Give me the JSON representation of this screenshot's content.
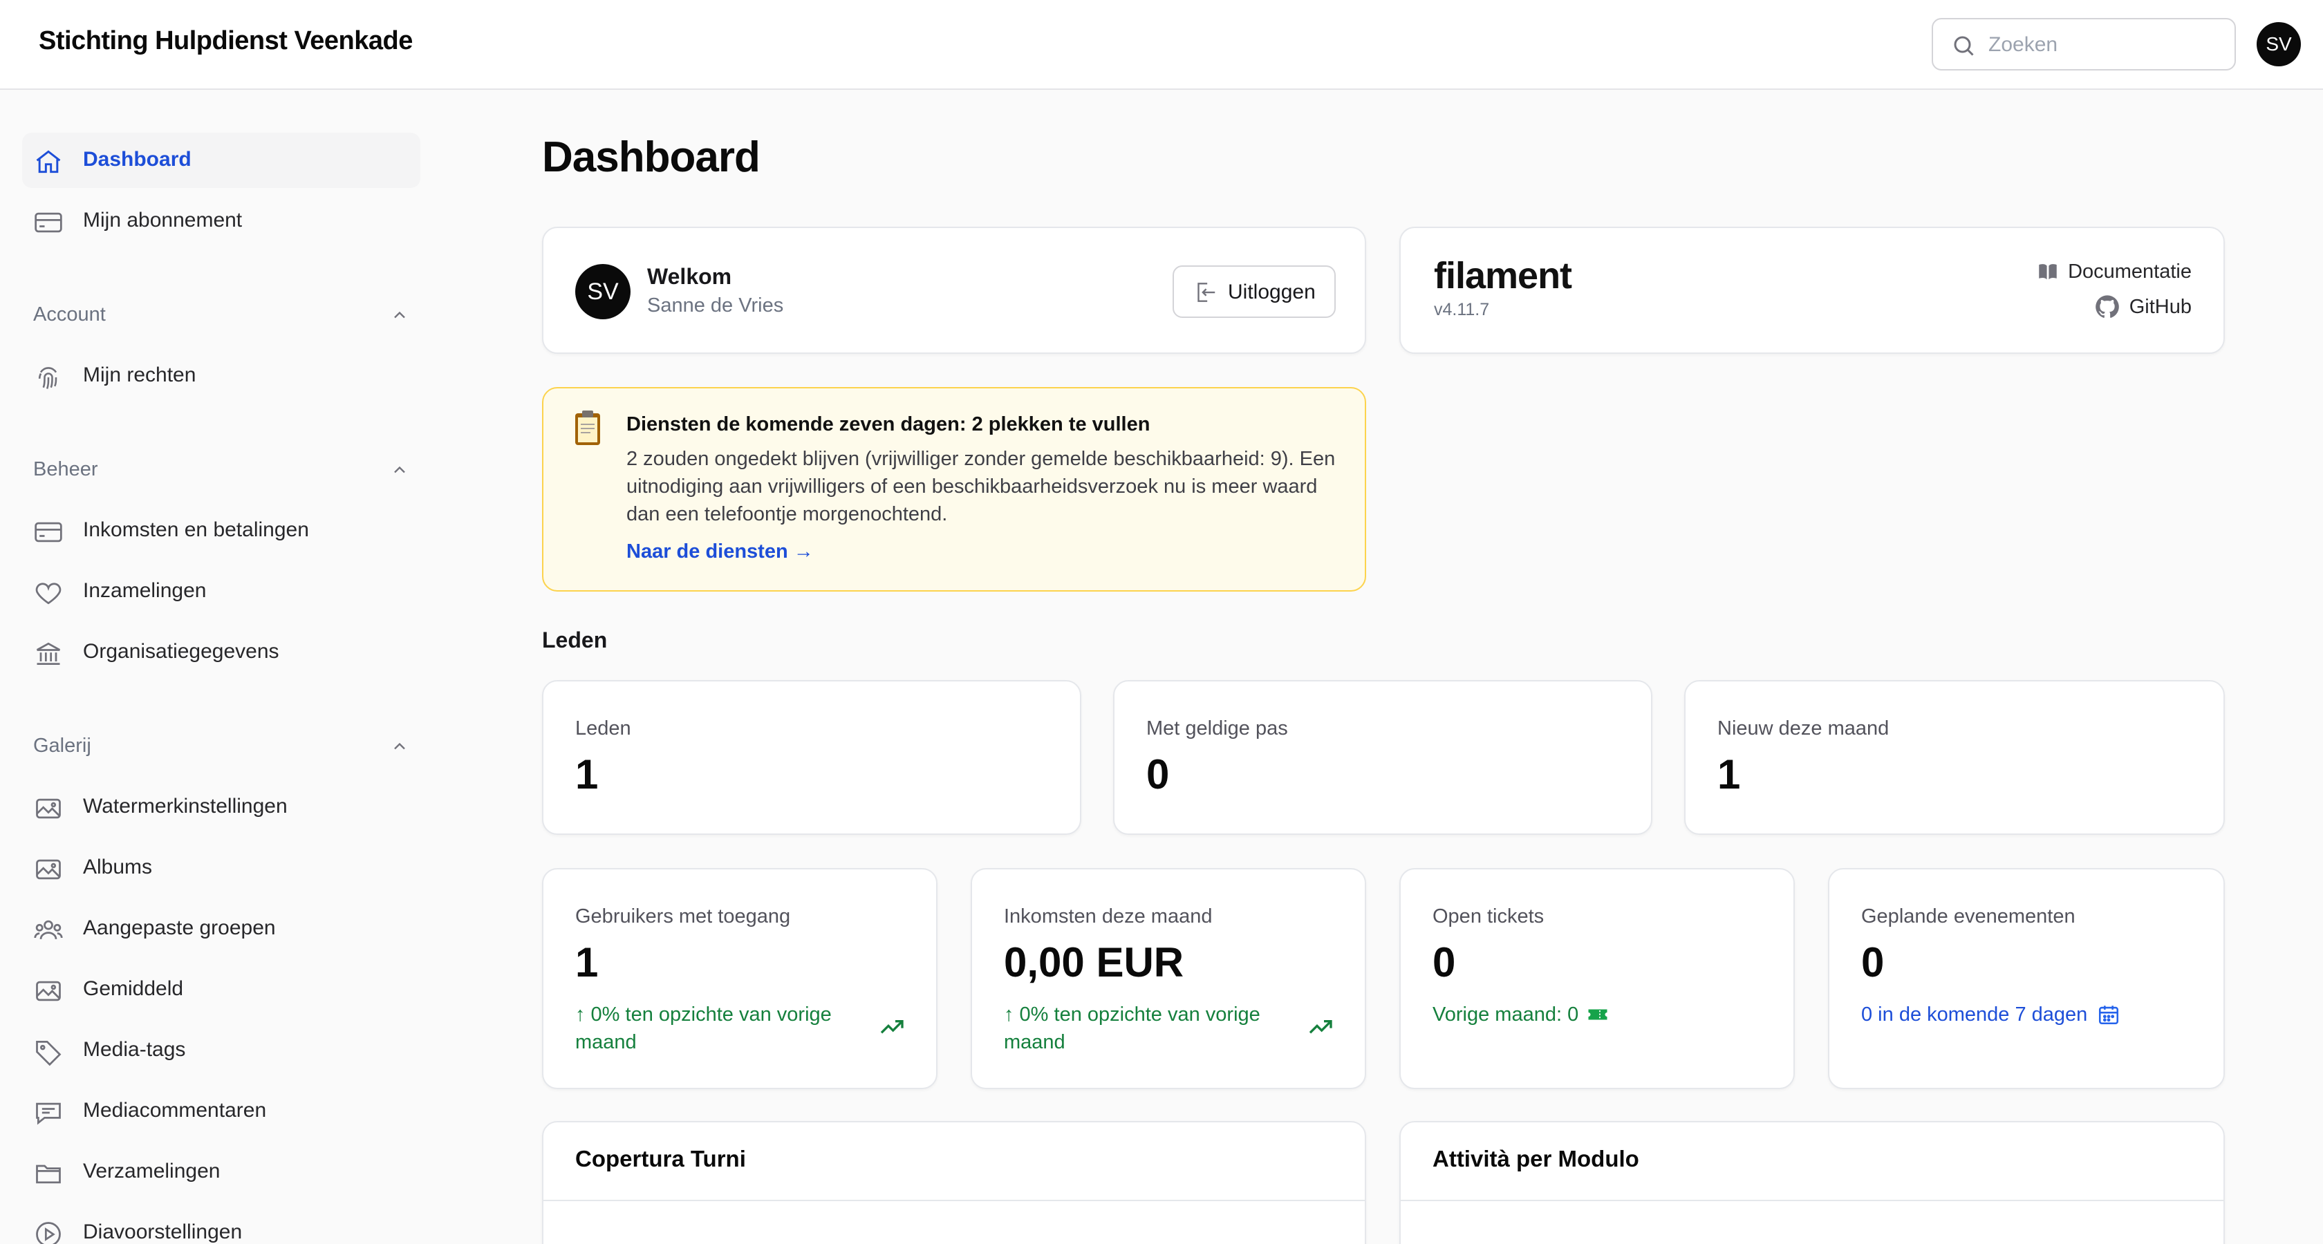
{
  "app": {
    "brand": "Stichting Hulpdienst Veenkade",
    "search_placeholder": "Zoeken",
    "user_initials": "SV"
  },
  "sidebar": {
    "top_items": [
      {
        "label": "Dashboard",
        "icon": "home-icon",
        "active": true
      },
      {
        "label": "Mijn abonnement",
        "icon": "credit-card-icon"
      }
    ],
    "groups": [
      {
        "label": "Account",
        "items": [
          {
            "label": "Mijn rechten",
            "icon": "fingerprint-icon"
          }
        ]
      },
      {
        "label": "Beheer",
        "items": [
          {
            "label": "Inkomsten en betalingen",
            "icon": "credit-card-icon"
          },
          {
            "label": "Inzamelingen",
            "icon": "heart-icon"
          },
          {
            "label": "Organisatiegegevens",
            "icon": "bank-icon"
          }
        ]
      },
      {
        "label": "Galerij",
        "items": [
          {
            "label": "Watermerkinstellingen",
            "icon": "image-icon"
          },
          {
            "label": "Albums",
            "icon": "image-icon"
          },
          {
            "label": "Aangepaste groepen",
            "icon": "users-icon"
          },
          {
            "label": "Gemiddeld",
            "icon": "image-icon"
          },
          {
            "label": "Media-tags",
            "icon": "tag-icon"
          },
          {
            "label": "Mediacommentaren",
            "icon": "chat-icon"
          },
          {
            "label": "Verzamelingen",
            "icon": "folder-icon"
          },
          {
            "label": "Diavoorstellingen",
            "icon": "play-icon"
          }
        ]
      }
    ]
  },
  "main": {
    "title": "Dashboard",
    "welcome": {
      "title": "Welkom",
      "name": "Sanne de Vries",
      "initials": "SV",
      "logout_label": "Uitloggen"
    },
    "filament": {
      "logo": "filament",
      "version": "v4.11.7",
      "docs_label": "Documentatie",
      "github_label": "GitHub"
    },
    "notice": {
      "title": "Diensten de komende zeven dagen: 2 plekken te vullen",
      "body": "2 zouden ongedekt blijven (vrijwilliger zonder gemelde beschikbaarheid: 9). Een uitnodiging aan vrijwilligers of een beschikbaarheidsverzoek nu is meer waard dan een telefoontje morgenochtend.",
      "link": "Naar de diensten →"
    },
    "members_section": "Leden",
    "member_stats": [
      {
        "label": "Leden",
        "value": "1"
      },
      {
        "label": "Met geldige pas",
        "value": "0"
      },
      {
        "label": "Nieuw deze maand",
        "value": "1"
      }
    ],
    "stats": [
      {
        "label": "Gebruikers met toegang",
        "value": "1",
        "desc": "↑ 0% ten opzichte van vorige maand"
      },
      {
        "label": "Inkomsten deze maand",
        "value": "0,00 EUR",
        "desc": "↑ 0% ten opzichte van vorige maand"
      },
      {
        "label": "Open tickets",
        "value": "0",
        "desc": "Vorige maand: 0"
      },
      {
        "label": "Geplande evenementen",
        "value": "0",
        "desc": "0 in de komende 7 dagen"
      }
    ],
    "charts": [
      {
        "title": "Copertura Turni"
      },
      {
        "title": "Attività per Modulo"
      }
    ]
  },
  "colors": {
    "accent": "#1d4ed8",
    "success": "#15803d",
    "warning_bg": "#fefbeb",
    "warning_border": "#fcd34d"
  }
}
